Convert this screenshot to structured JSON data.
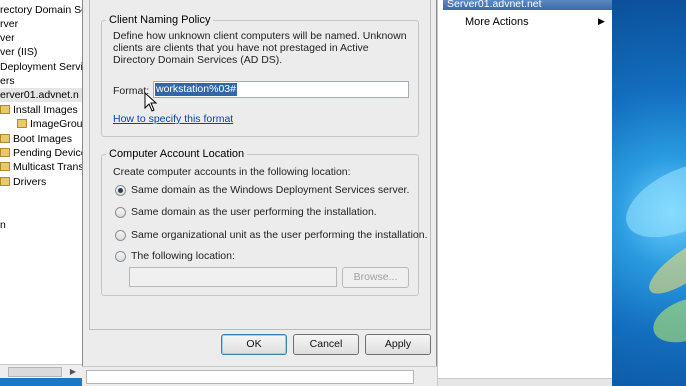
{
  "tree": {
    "items": [
      {
        "label": "rectory Domain Se"
      },
      {
        "label": "rver"
      },
      {
        "label": "ver"
      },
      {
        "label": "ver (IIS)"
      },
      {
        "label": "Deployment Servi"
      },
      {
        "label": "ers"
      },
      {
        "label": "erver01.advnet.n"
      },
      {
        "label": "Install Images"
      },
      {
        "label": "ImageGroup"
      },
      {
        "label": "Boot Images"
      },
      {
        "label": "Pending Device"
      },
      {
        "label": "Multicast Transi"
      },
      {
        "label": "Drivers"
      },
      {
        "label": "n"
      }
    ]
  },
  "actions": {
    "header": "Server01.advnet.net",
    "more_actions": "More Actions"
  },
  "dialog": {
    "naming_group": {
      "title": "Client Naming Policy",
      "description": "Define how unknown client computers will be named. Unknown clients are clients that you have not prestaged in Active Directory Domain Services (AD DS).",
      "format_label": "Format:",
      "format_value": "workstation%03#",
      "help_link": "How to specify this format"
    },
    "location_group": {
      "title": "Computer Account Location",
      "intro": "Create computer accounts in the following location:",
      "options": [
        {
          "label": "Same domain as the Windows Deployment Services server.",
          "checked": true
        },
        {
          "label": "Same domain as the user performing the installation.",
          "checked": false
        },
        {
          "label": "Same organizational unit as the user performing the installation.",
          "checked": false
        },
        {
          "label": "The following location:",
          "checked": false
        }
      ],
      "location_value": "",
      "browse_label": "Browse..."
    },
    "buttons": {
      "ok": "OK",
      "cancel": "Cancel",
      "apply": "Apply"
    }
  }
}
